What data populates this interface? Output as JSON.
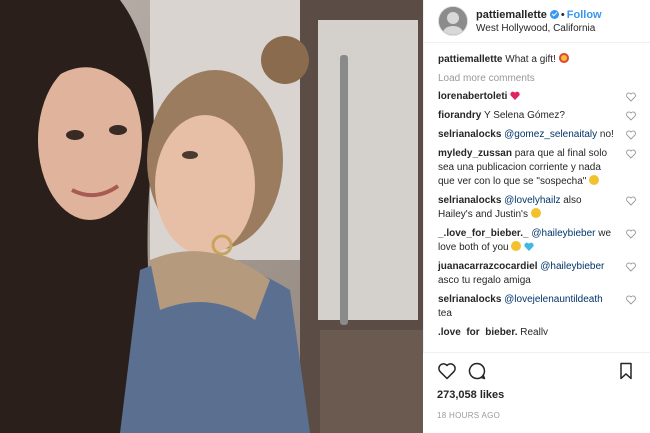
{
  "post": {
    "username": "pattiemallette",
    "follow_label": "Follow",
    "location": "West Hollywood, California",
    "caption_user": "pattiemallette",
    "caption_text": "What a gift!",
    "load_more": "Load more comments",
    "likes": "273,058 likes",
    "time": "18 HOURS AGO"
  },
  "comments": [
    {
      "user": "lorenabertoleti",
      "pre": "",
      "mention": "",
      "text": ""
    },
    {
      "user": "fiorandry",
      "pre": "Y Selena Gómez?",
      "mention": "",
      "text": ""
    },
    {
      "user": "selrianalocks",
      "pre": "",
      "mention": "@gomez_selenaitaly",
      "text": " no!"
    },
    {
      "user": "myledy_zussan",
      "pre": "para que al final solo sea una publicacion corriente y nada que ver con lo que se \"sospecha\"",
      "mention": "",
      "text": ""
    },
    {
      "user": "selrianalocks",
      "pre": "",
      "mention": "@lovelyhailz",
      "text": " also Hailey's and Justin's"
    },
    {
      "user": "_.love_for_bieber._",
      "pre": "",
      "mention": "@haileybieber",
      "text": " we love both of you"
    },
    {
      "user": "juanacarrazcocardiel",
      "pre": "",
      "mention": "@haileybieber",
      "text": " asco tu regalo amiga"
    },
    {
      "user": "selrianalocks",
      "pre": "",
      "mention": "@lovejelenauntildeath",
      "text": " tea"
    },
    {
      "user": ".love_for_bieber.",
      "pre": "Really",
      "mention": "",
      "text": ""
    }
  ],
  "icons": {
    "heart": "heart-icon",
    "comment": "comment-icon",
    "bookmark": "bookmark-icon"
  }
}
